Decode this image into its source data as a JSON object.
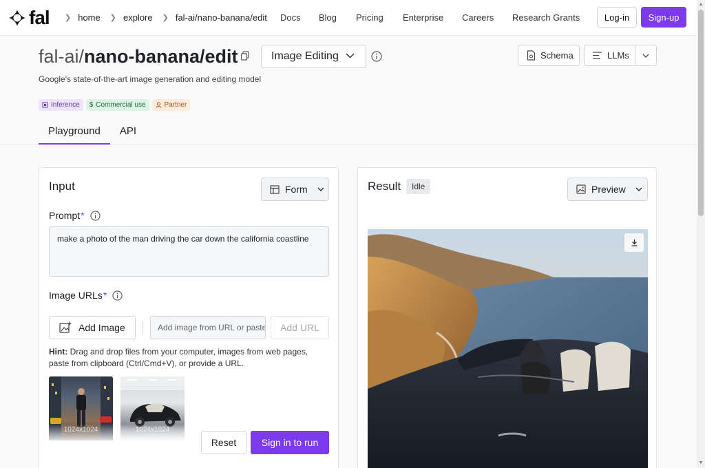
{
  "nav": {
    "logo_text": "fal",
    "breadcrumbs": [
      "home",
      "explore",
      "fal-ai/nano-banana/edit"
    ],
    "links": [
      "Docs",
      "Blog",
      "Pricing",
      "Enterprise",
      "Careers",
      "Research Grants"
    ],
    "login_label": "Log-in",
    "signup_label": "Sign-up",
    "accent_color": "#7c3aed"
  },
  "model": {
    "prefix": "fal-ai/",
    "name": "nano-banana/edit",
    "category": "Image Editing",
    "description": "Google's state-of-the-art image generation and editing model",
    "badges": [
      {
        "label": "Inference",
        "icon": "inference-icon"
      },
      {
        "label": "Commercial use",
        "icon": "dollar-icon"
      },
      {
        "label": "Partner",
        "icon": "partner-icon"
      }
    ],
    "schema_label": "Schema",
    "llms_label": "LLMs"
  },
  "tabs": [
    {
      "label": "Playground",
      "active": true
    },
    {
      "label": "API",
      "active": false
    }
  ],
  "input": {
    "title": "Input",
    "form_label": "Form",
    "prompt_label": "Prompt",
    "required_mark": "*",
    "prompt_value": "make a photo of the man driving the car down the california coastline",
    "image_urls_label": "Image URLs",
    "add_image_label": "Add Image",
    "url_placeholder": "Add image from URL or paste",
    "add_url_label": "Add URL",
    "hint_label": "Hint:",
    "hint_text": " Drag and drop files from your computer, images from web pages, paste from clipboard (Ctrl/Cmd+V), or provide a URL.",
    "thumbnails": [
      {
        "label": "1024x1024"
      },
      {
        "label": "1024x1024"
      }
    ],
    "reset_label": "Reset",
    "run_label": "Sign in to run"
  },
  "result": {
    "title": "Result",
    "status": "Idle",
    "preview_label": "Preview"
  }
}
